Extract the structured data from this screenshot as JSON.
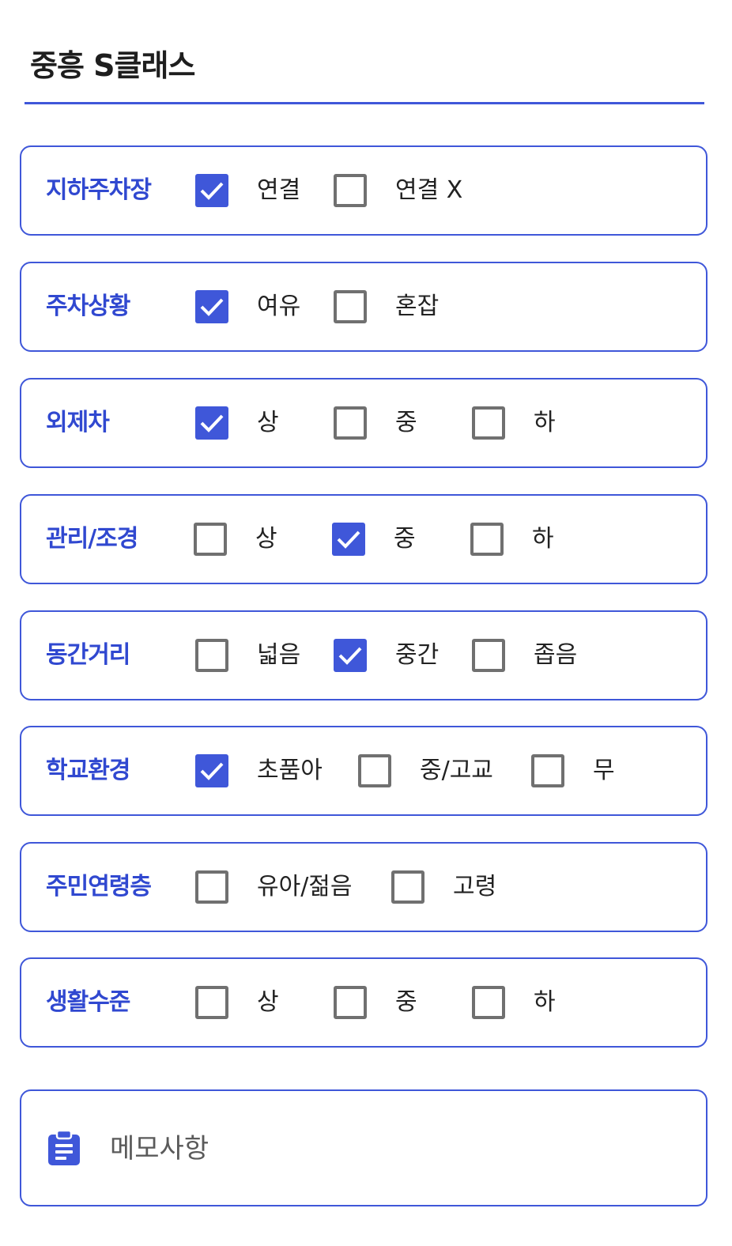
{
  "title": "중흥 S클래스",
  "rows": [
    {
      "label": "지하주차장",
      "options": [
        {
          "label": "연결",
          "checked": true
        },
        {
          "label": "연결 X",
          "checked": false
        }
      ]
    },
    {
      "label": "주차상황",
      "options": [
        {
          "label": "여유",
          "checked": true
        },
        {
          "label": "혼잡",
          "checked": false
        }
      ]
    },
    {
      "label": "외제차",
      "options": [
        {
          "label": "상",
          "checked": true
        },
        {
          "label": "중",
          "checked": false
        },
        {
          "label": "하",
          "checked": false
        }
      ]
    },
    {
      "label": "관리/조경",
      "options": [
        {
          "label": "상",
          "checked": false
        },
        {
          "label": "중",
          "checked": true
        },
        {
          "label": "하",
          "checked": false
        }
      ]
    },
    {
      "label": "동간거리",
      "options": [
        {
          "label": "넓음",
          "checked": false
        },
        {
          "label": "중간",
          "checked": true
        },
        {
          "label": "좁음",
          "checked": false
        }
      ]
    },
    {
      "label": "학교환경",
      "options": [
        {
          "label": "초품아",
          "checked": true
        },
        {
          "label": "중/고교",
          "checked": false
        },
        {
          "label": "무",
          "checked": false
        }
      ]
    },
    {
      "label": "주민연령층",
      "options": [
        {
          "label": "유아/젊음",
          "checked": false
        },
        {
          "label": "고령",
          "checked": false
        }
      ]
    },
    {
      "label": "생활수준",
      "options": [
        {
          "label": "상",
          "checked": false
        },
        {
          "label": "중",
          "checked": false
        },
        {
          "label": "하",
          "checked": false
        }
      ]
    }
  ],
  "memo": {
    "placeholder": "메모사항",
    "value": "",
    "icon": "clipboard-icon"
  },
  "colors": {
    "accent": "#3f57d9",
    "label": "#3048d0",
    "unchecked_border": "#707070"
  }
}
